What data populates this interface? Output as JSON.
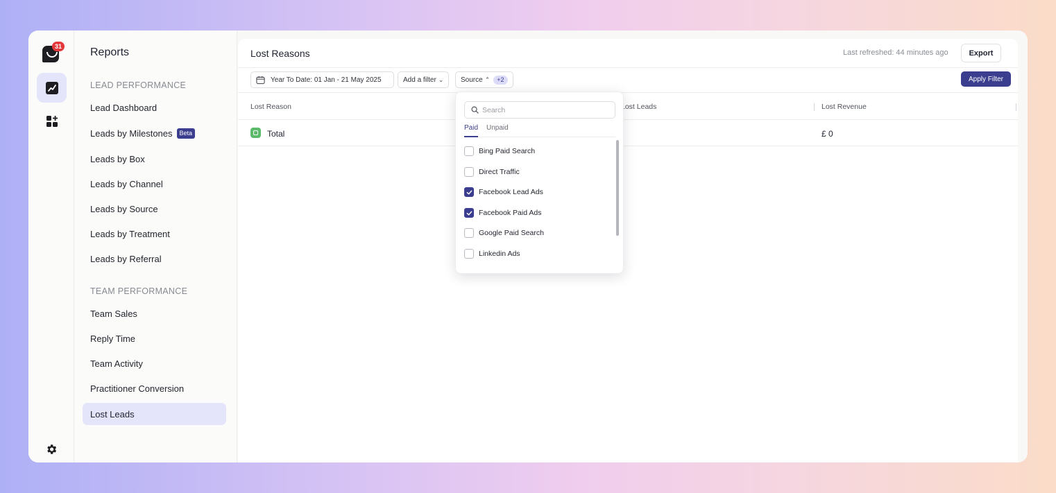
{
  "rail": {
    "notification_count": "31",
    "icons": [
      "logo-icon",
      "reports-chart-icon",
      "apps-grid-icon",
      "gear-icon"
    ]
  },
  "sidebar": {
    "title": "Reports",
    "lead_section": "LEAD PERFORMANCE",
    "lead_items": [
      {
        "label": "Lead Dashboard"
      },
      {
        "label": "Leads by Milestones",
        "badge": "Beta"
      },
      {
        "label": "Leads by Box"
      },
      {
        "label": "Leads by Channel"
      },
      {
        "label": "Leads by Source"
      },
      {
        "label": "Leads by Treatment"
      },
      {
        "label": "Leads by Referral"
      }
    ],
    "team_section": "TEAM PERFORMANCE",
    "team_items": [
      {
        "label": "Team Sales"
      },
      {
        "label": "Reply Time"
      },
      {
        "label": "Team Activity"
      },
      {
        "label": "Practitioner Conversion"
      },
      {
        "label": "Lost Leads",
        "active": true
      }
    ]
  },
  "main": {
    "title": "Lost Reasons",
    "refreshed": "Last refreshed: 44 minutes ago",
    "export_label": "Export",
    "filters": {
      "date_range": "Year To Date: 01 Jan - 21 May 2025",
      "add_filter": "Add a filter",
      "source": "Source",
      "source_extra": "+2",
      "apply_label": "Apply Filter"
    },
    "table": {
      "columns": [
        "Lost Reason",
        "Lost Leads",
        "Lost Revenue"
      ],
      "rows": [
        {
          "reason": "Total",
          "leads": "",
          "revenue": "£ 0"
        }
      ]
    }
  },
  "dropdown": {
    "search_placeholder": "Search",
    "tabs": [
      "Paid",
      "Unpaid"
    ],
    "active_tab": "Paid",
    "options": [
      {
        "label": "Bing Paid Search",
        "checked": false
      },
      {
        "label": "Direct Traffic",
        "checked": false
      },
      {
        "label": "Facebook Lead Ads",
        "checked": true
      },
      {
        "label": "Facebook Paid Ads",
        "checked": true
      },
      {
        "label": "Google Paid Search",
        "checked": false
      },
      {
        "label": "Linkedin Ads",
        "checked": false
      }
    ]
  },
  "colors": {
    "accent": "#3b3e8e",
    "active_bg": "#e4e4fb",
    "badge_red": "#e5383b",
    "total_green": "#5bbb6a"
  }
}
